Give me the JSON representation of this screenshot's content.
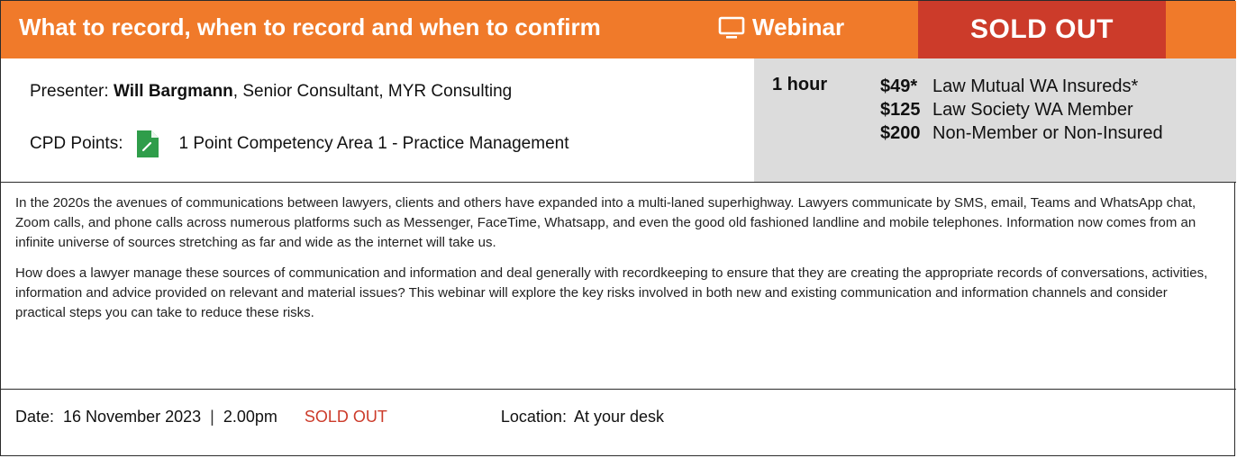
{
  "header": {
    "title": "What to record, when to record and when to confirm",
    "format_icon": "monitor-icon",
    "format_label": "Webinar",
    "status_badge": "SOLD OUT",
    "colors": {
      "header_bg": "#f07a2a",
      "badge_bg": "#cc3b2a"
    }
  },
  "info": {
    "presenter_label": "Presenter:",
    "presenter_name": "Will Bargmann",
    "presenter_role": ", Senior Consultant, MYR Consulting",
    "cpd_label": "CPD Points:",
    "cpd_icon": "document-icon",
    "cpd_value": "1 Point Competency Area 1 - Practice Management"
  },
  "pricing": {
    "duration": "1 hour",
    "rows": [
      {
        "amount": "$49*",
        "audience": "Law Mutual WA Insureds*"
      },
      {
        "amount": "$125",
        "audience": "Law Society WA Member"
      },
      {
        "amount": "$200",
        "audience": "Non-Member or Non-Insured"
      }
    ],
    "colors": {
      "panel_bg": "#dcdcdc"
    }
  },
  "description": {
    "paragraphs": [
      "In the 2020s the avenues of communications between lawyers, clients and others have expanded into a multi-laned superhighway. Lawyers communicate by SMS, email, Teams and WhatsApp chat, Zoom calls, and phone calls across numerous platforms such as Messenger, FaceTime, Whatsapp, and even the good old fashioned landline and mobile telephones. Information now comes from an infinite universe of sources stretching as far and wide as the internet will take us.",
      "How does a lawyer manage these sources of communication and information and deal generally with recordkeeping to ensure that they are creating the appropriate records of conversations, activities, information and advice provided on relevant and material issues? This webinar will explore the key risks involved in both new and existing communication and information channels and consider practical steps you can take to reduce these risks."
    ]
  },
  "footer": {
    "date_label": "Date:",
    "date_value": "16 November 2023",
    "separator": "|",
    "time_value": "2.00pm",
    "status": "SOLD OUT",
    "location_label": "Location:",
    "location_value": "At your desk"
  }
}
